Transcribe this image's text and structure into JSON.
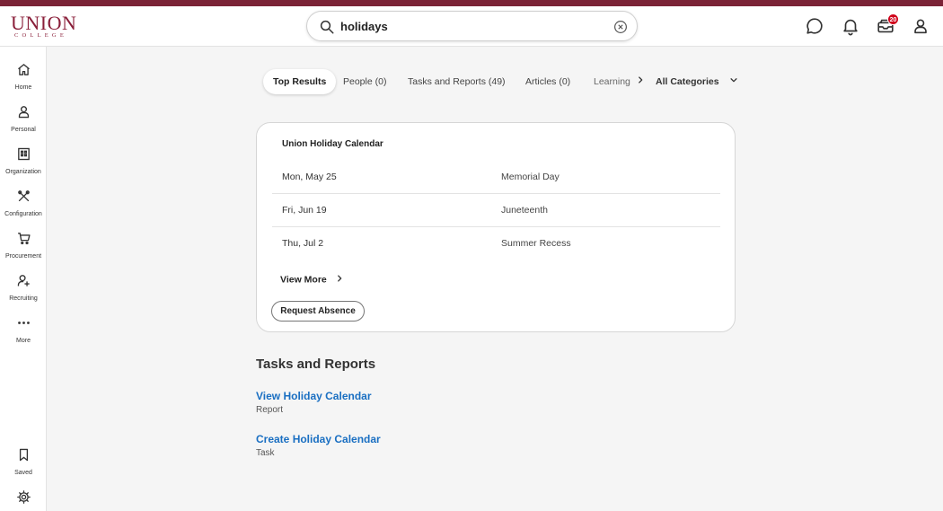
{
  "brand": {
    "line1": "UNION",
    "line2": "COLLEGE",
    "color": "#8a1f3a"
  },
  "search": {
    "value": "holidays"
  },
  "header": {
    "notification_count": "20"
  },
  "sidebar": {
    "items": [
      {
        "label": "Home",
        "icon": "home-icon"
      },
      {
        "label": "Personal",
        "icon": "person-icon"
      },
      {
        "label": "Organization",
        "icon": "building-icon"
      },
      {
        "label": "Configuration",
        "icon": "tools-icon"
      },
      {
        "label": "Procurement",
        "icon": "cart-icon"
      },
      {
        "label": "Recruiting",
        "icon": "add-person-icon"
      },
      {
        "label": "More",
        "icon": "more-dots-icon"
      }
    ],
    "saved": {
      "label": "Saved",
      "icon": "bookmark-icon"
    },
    "settings": {
      "icon": "gear-icon"
    }
  },
  "tabs": [
    {
      "label": "Top Results",
      "active": true
    },
    {
      "label": "People (0)"
    },
    {
      "label": "Tasks and Reports (49)"
    },
    {
      "label": "Articles (0)"
    },
    {
      "label": "Learning"
    },
    {
      "label": "All Categories"
    }
  ],
  "calendar_card": {
    "title": "Union Holiday Calendar",
    "holidays": [
      {
        "date": "Mon, May 25",
        "name": "Memorial Day"
      },
      {
        "date": "Fri, Jun 19",
        "name": "Juneteenth"
      },
      {
        "date": "Thu, Jul 2",
        "name": "Summer Recess"
      }
    ],
    "view_more": "View More",
    "request_absence": "Request Absence"
  },
  "tasks_reports": {
    "title": "Tasks and Reports",
    "items": [
      {
        "title": "View Holiday Calendar",
        "type": "Report"
      },
      {
        "title": "Create Holiday Calendar",
        "type": "Task"
      }
    ]
  },
  "colors": {
    "accent_strip": "#7b2337",
    "link": "#1a6fc2",
    "badge": "#d0021b"
  }
}
